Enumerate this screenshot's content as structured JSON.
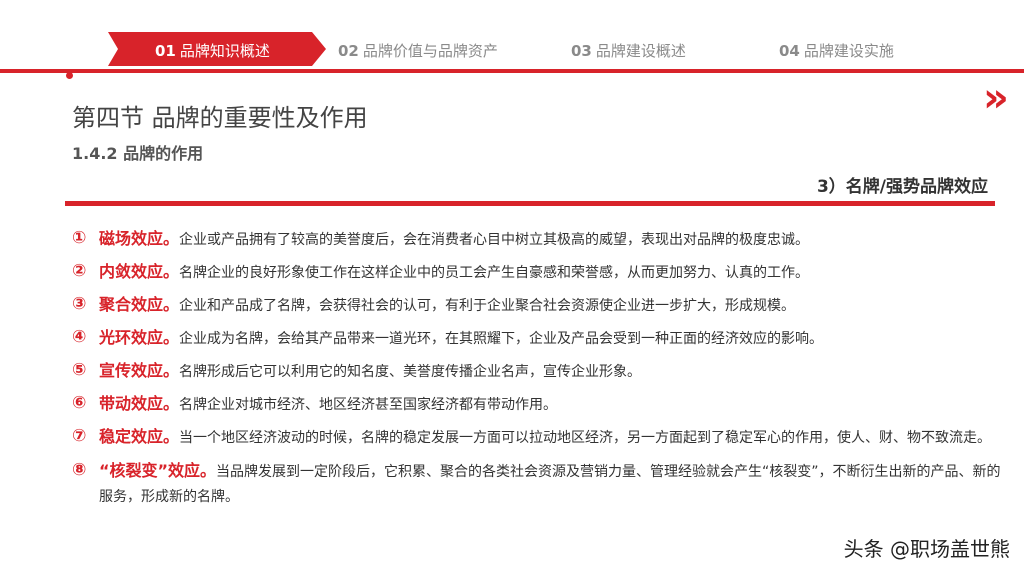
{
  "nav": {
    "tabs": [
      {
        "num": "01",
        "label": "品牌知识概述"
      },
      {
        "num": "02",
        "label": "品牌价值与品牌资产"
      },
      {
        "num": "03",
        "label": "品牌建设概述"
      },
      {
        "num": "04",
        "label": "品牌建设实施"
      }
    ],
    "active_index": 0
  },
  "decor": {
    "chevrons": "»"
  },
  "section_title": "第四节  品牌的重要性及作用",
  "sub_title": "1.4.2 品牌的作用",
  "topic": "3）名牌/强势品牌效应",
  "items": [
    {
      "mark": "①",
      "term": "磁场效应。",
      "text": "企业或产品拥有了较高的美誉度后，会在消费者心目中树立其极高的威望，表现出对品牌的极度忠诚。"
    },
    {
      "mark": "②",
      "term": "内敛效应。",
      "text": "名牌企业的良好形象使工作在这样企业中的员工会产生自豪感和荣誉感，从而更加努力、认真的工作。"
    },
    {
      "mark": "③",
      "term": "聚合效应。",
      "text": "企业和产品成了名牌，会获得社会的认可，有利于企业聚合社会资源使企业进一步扩大，形成规模。"
    },
    {
      "mark": "④",
      "term": "光环效应。",
      "text": "企业成为名牌，会给其产品带来一道光环，在其照耀下，企业及产品会受到一种正面的经济效应的影响。"
    },
    {
      "mark": "⑤",
      "term": "宣传效应。",
      "text": "名牌形成后它可以利用它的知名度、美誉度传播企业名声，宣传企业形象。"
    },
    {
      "mark": "⑥",
      "term": "带动效应。",
      "text": "名牌企业对城市经济、地区经济甚至国家经济都有带动作用。"
    },
    {
      "mark": "⑦",
      "term": "稳定效应。",
      "text": "当一个地区经济波动的时候，名牌的稳定发展一方面可以拉动地区经济，另一方面起到了稳定军心的作用，使人、财、物不致流走。"
    },
    {
      "mark": "⑧",
      "term": " “核裂变”效应。",
      "text": "当品牌发展到一定阶段后，它积累、聚合的各类社会资源及营销力量、管理经验就会产生“核裂变”，不断衍生出新的产品、新的服务，形成新的名牌。"
    }
  ],
  "watermark": "头条 @职场盖世熊",
  "colors": {
    "accent": "#d8232a",
    "text": "#333333",
    "muted": "#8a8a8a"
  }
}
